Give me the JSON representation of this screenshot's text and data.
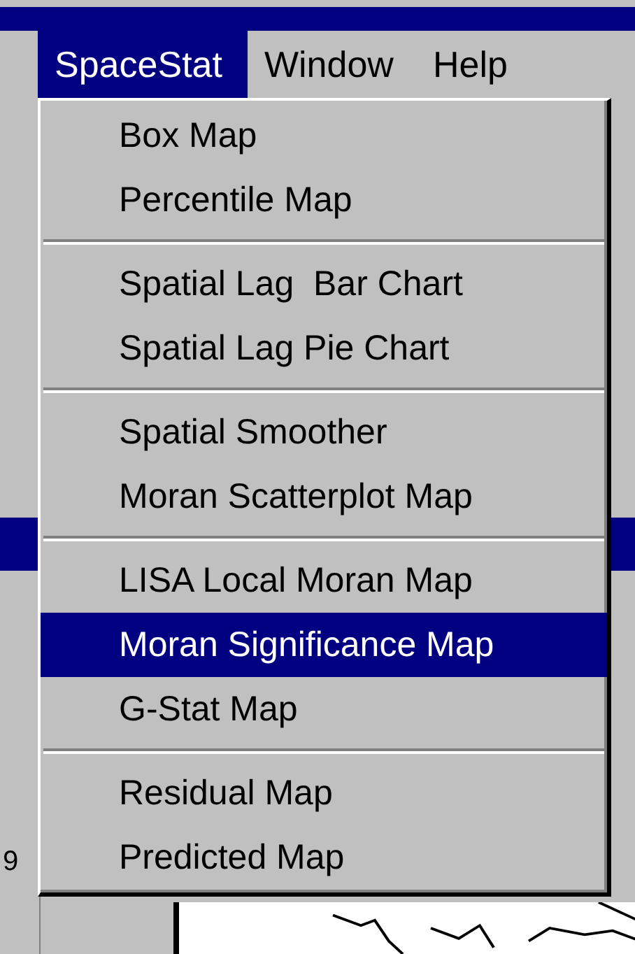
{
  "menu_bar": [
    {
      "label": "SpaceStat",
      "selected": true
    },
    {
      "label": "Window",
      "selected": false
    },
    {
      "label": "Help",
      "selected": false
    }
  ],
  "menu": {
    "groups": [
      [
        {
          "label": "Box Map",
          "selected": false
        },
        {
          "label": "Percentile Map",
          "selected": false
        }
      ],
      [
        {
          "label": "Spatial Lag  Bar Chart",
          "selected": false
        },
        {
          "label": "Spatial Lag Pie Chart",
          "selected": false
        }
      ],
      [
        {
          "label": "Spatial Smoother",
          "selected": false
        },
        {
          "label": "Moran Scatterplot Map",
          "selected": false
        }
      ],
      [
        {
          "label": "LISA Local Moran Map",
          "selected": false
        },
        {
          "label": "Moran Significance Map",
          "selected": true
        },
        {
          "label": "G-Stat Map",
          "selected": false
        }
      ],
      [
        {
          "label": "Residual Map",
          "selected": false
        },
        {
          "label": "Predicted Map",
          "selected": false
        }
      ]
    ]
  },
  "background_label": "9"
}
